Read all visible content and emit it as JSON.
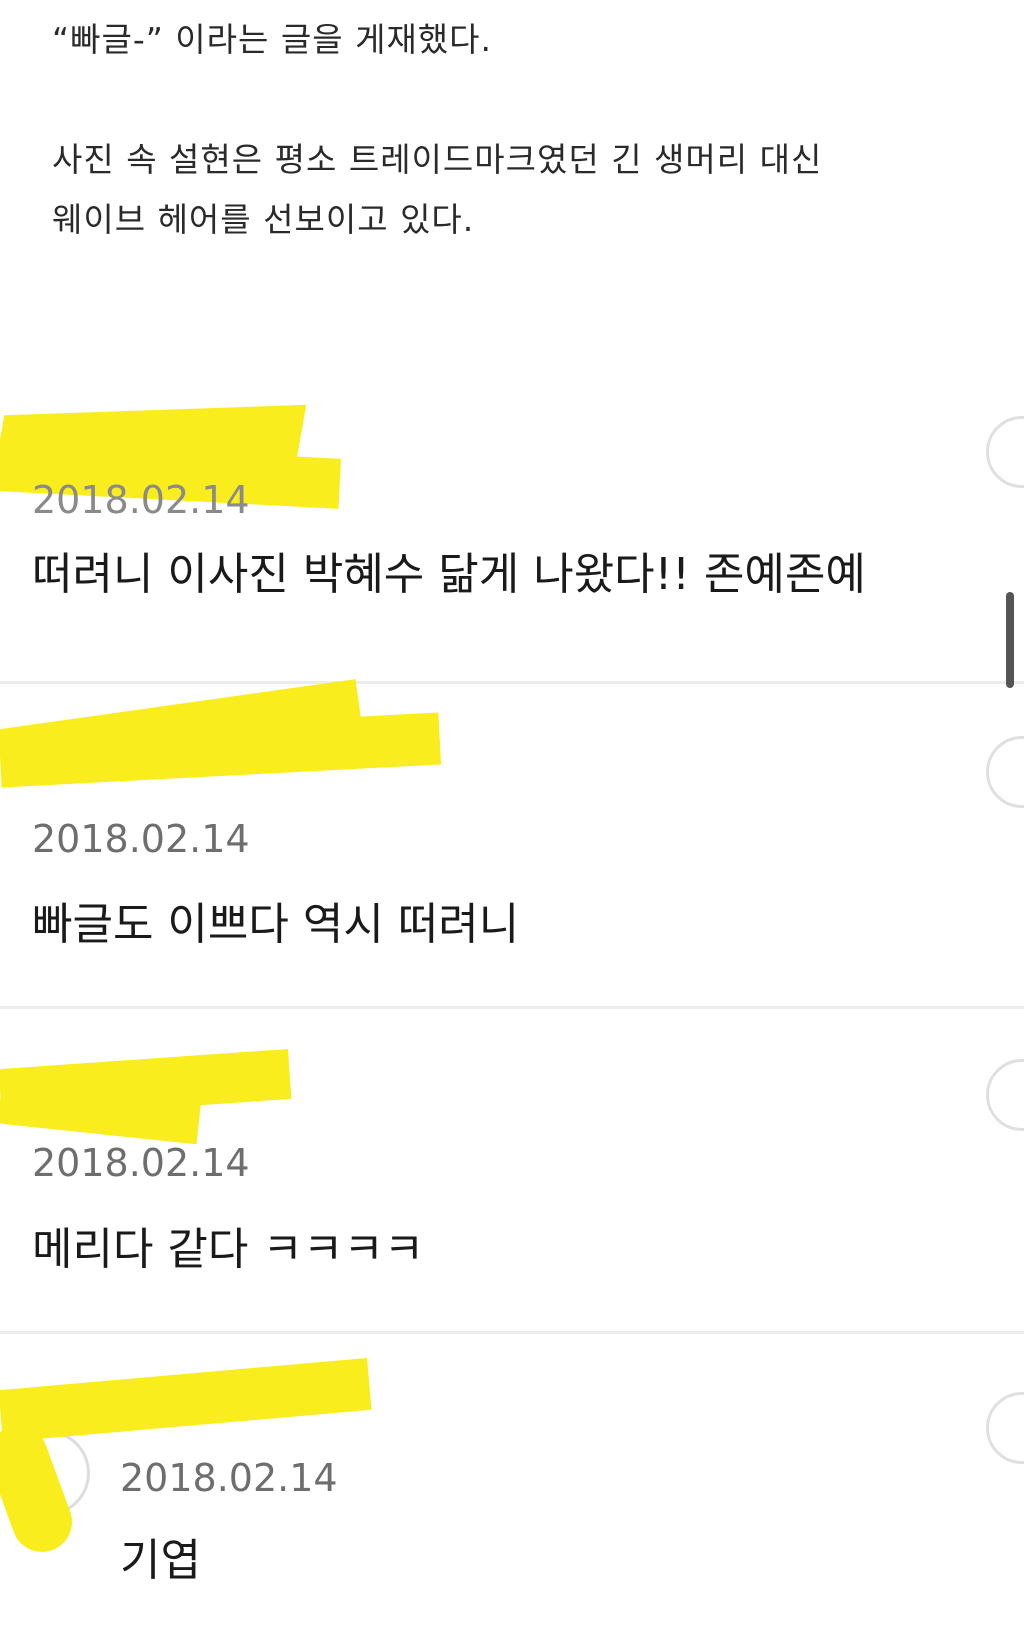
{
  "article": {
    "lines": [
      "“빠글-” 이라는 글을 게재했다.",
      "사진 속 설현은 평소 트레이드마크였던 긴 생머리 대신",
      "웨이브 헤어를 선보이고 있다."
    ]
  },
  "comments": [
    {
      "date": "2018.02.14",
      "text": "떠려니 이사진 박혜수 닮게 나왔다!! 존예존예"
    },
    {
      "date": "2018.02.14",
      "text": "빠글도 이쁘다 역시 떠려니"
    },
    {
      "date": "2018.02.14",
      "text": "메리다 같다 ㅋㅋㅋㅋ"
    },
    {
      "date": "2018.02.14",
      "text": "기엽"
    }
  ],
  "colors": {
    "redaction": "#f9ed1e",
    "divider": "#ececec",
    "date_text": "#6e6e6e"
  }
}
